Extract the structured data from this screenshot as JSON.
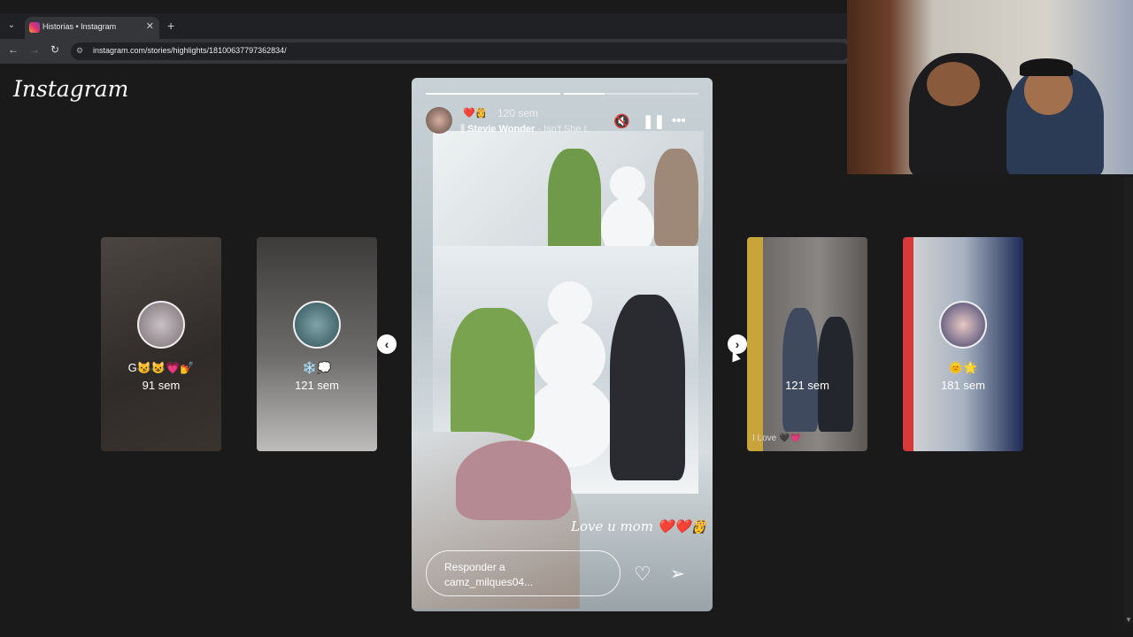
{
  "browser": {
    "tab_title": "Historias • Instagram",
    "new_tab": "+",
    "url": "instagram.com/stories/highlights/18100637797362834/"
  },
  "logo": "Instagram",
  "side_cards": [
    {
      "emoji": "G😼😺💗💅",
      "time": "91 sem"
    },
    {
      "emoji": "❄️💭",
      "time": "121 sem"
    },
    {
      "emoji": "",
      "time": "121 sem"
    },
    {
      "emoji": "🌞🌟",
      "time": "181 sem"
    }
  ],
  "story": {
    "emojis": "❤️👸",
    "time": "120 sem",
    "artist": "Stevie Wonder",
    "song": "· Isn't She L",
    "caption": "Love u mom ❤️❤️👸",
    "reply_line1": "Responder a",
    "reply_line2": "camz_milques04...",
    "progress": [
      1.0,
      0.3
    ]
  },
  "card_caption": "I Love 🖤💗",
  "colors": {
    "bg": "#1a1a1a",
    "story_bg": "#c8d2d6"
  }
}
